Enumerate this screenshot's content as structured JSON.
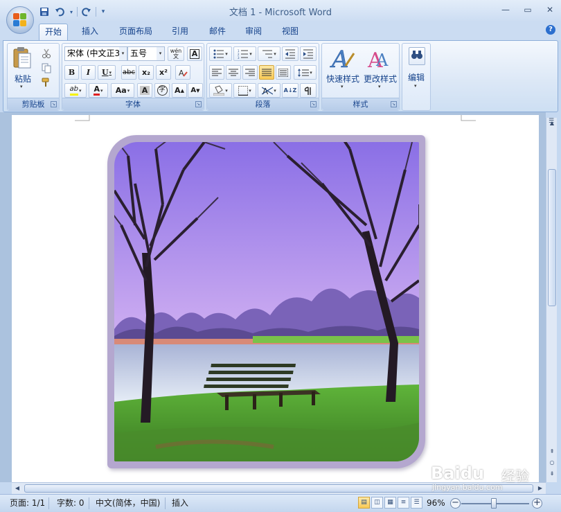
{
  "window": {
    "title": "文档 1 - Microsoft Word",
    "controls": {
      "minimize": "—",
      "maximize": "▭",
      "close": "✕"
    }
  },
  "quick_access": {
    "customize_symbol": "▾"
  },
  "tabs": [
    {
      "label": "开始",
      "active": true
    },
    {
      "label": "插入",
      "active": false
    },
    {
      "label": "页面布局",
      "active": false
    },
    {
      "label": "引用",
      "active": false
    },
    {
      "label": "邮件",
      "active": false
    },
    {
      "label": "审阅",
      "active": false
    },
    {
      "label": "视图",
      "active": false
    }
  ],
  "help_symbol": "?",
  "ribbon": {
    "clipboard": {
      "label": "剪贴板",
      "paste_label": "粘贴"
    },
    "font": {
      "label": "字体",
      "font_name": "宋体 (中文正3",
      "font_size": "五号",
      "phonetic_label": "wén\n文",
      "border_char": "A",
      "bold": "B",
      "italic": "I",
      "underline": "U",
      "strikethrough": "abc",
      "subscript": "x₂",
      "superscript": "x²",
      "clear_format": "A",
      "highlight": "ab",
      "font_color": "A",
      "change_case": "Aa",
      "char_shading": "A",
      "enclose_char": "字",
      "grow_font": "A",
      "shrink_font": "A"
    },
    "paragraph": {
      "label": "段落",
      "sort_label": "A↓Z"
    },
    "styles": {
      "label": "样式",
      "quick_styles": "快速样式",
      "change_styles": "更改样式"
    },
    "editing": {
      "label": "编辑"
    }
  },
  "statusbar": {
    "page": "页面: 1/1",
    "words": "字数: 0",
    "language": "中文(简体，中国)",
    "mode": "插入",
    "zoom": "96%",
    "zoom_value": 0.96
  },
  "watermark": {
    "brand": "Baidu",
    "sub": "经验",
    "url": "jingyan.baidu.com"
  },
  "colors": {
    "accent": "#15428b",
    "ribbon_bg": "#dbe7f6",
    "frame": "#b4a7cf",
    "sky": "#a88be8",
    "grass": "#4f9a2c",
    "water": "#c9d8ea"
  }
}
